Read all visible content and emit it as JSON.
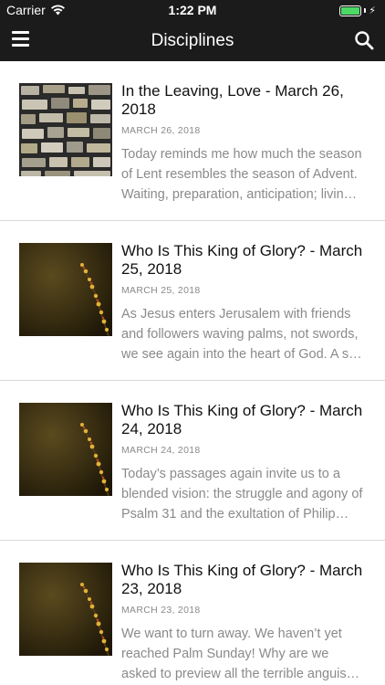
{
  "status_bar": {
    "carrier": "Carrier",
    "time": "1:22 PM",
    "battery_level": 1.0
  },
  "header": {
    "title": "Disciplines",
    "menu_icon": "hamburger-menu-icon",
    "search_icon": "search-icon"
  },
  "colors": {
    "header_bg": "#1b1b1b",
    "title_text": "#111111",
    "meta_text": "#8a8a8a",
    "divider": "#d9d9d9"
  },
  "posts": [
    {
      "title": "In the Leaving, Love - March 26, 2018",
      "date": "MARCH 26, 2018",
      "excerpt": "Today reminds me how much the season of Lent resembles the season of Advent. Waiting, preparation, anticipation; livin…",
      "thumbnail": "stone-wall"
    },
    {
      "title": "Who Is This King of Glory? - March 25, 2018",
      "date": "MARCH 25, 2018",
      "excerpt": "As Jesus enters Jerusalem with friends and followers waving palms, not swords, we see again into the heart of God. A s…",
      "thumbnail": "budding-branch"
    },
    {
      "title": "Who Is This King of Glory? - March 24, 2018",
      "date": "MARCH 24, 2018",
      "excerpt": "Today’s passages again invite us to a blended vision: the struggle and agony of Psalm 31 and the exultation of Philip…",
      "thumbnail": "budding-branch"
    },
    {
      "title": "Who Is This King of Glory? - March 23, 2018",
      "date": "MARCH 23, 2018",
      "excerpt": "We want to turn away. We haven’t yet reached Palm Sunday! Why are we asked to preview all the terrible anguis…",
      "thumbnail": "budding-branch"
    }
  ]
}
